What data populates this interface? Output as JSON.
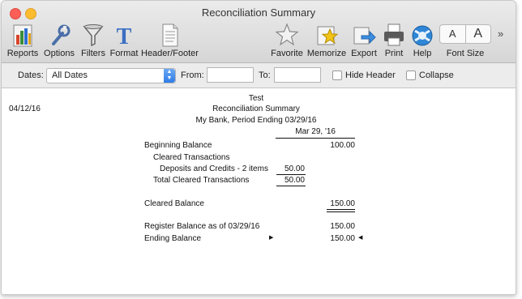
{
  "window": {
    "title": "Reconciliation Summary"
  },
  "toolbar": {
    "reports": "Reports",
    "options": "Options",
    "filters": "Filters",
    "format": "Format",
    "header_footer": "Header/Footer",
    "favorite": "Favorite",
    "memorize": "Memorize",
    "export": "Export",
    "print": "Print",
    "help": "Help",
    "font_size": "Font Size",
    "font_small": "A",
    "font_large": "A",
    "more": "»"
  },
  "filters": {
    "dates_label": "Dates:",
    "dates_value": "All Dates",
    "from_label": "From:",
    "to_label": "To:",
    "hide_header_label": "Hide Header",
    "collapse_label": "Collapse"
  },
  "report": {
    "date": "04/12/16",
    "file_name": "Test",
    "report_title": "Reconciliation Summary",
    "subtitle": "My Bank, Period Ending 03/29/16",
    "column_header": "Mar 29, '16",
    "rows": {
      "beginning_balance": {
        "label": "Beginning Balance",
        "value": "100.00"
      },
      "cleared_transactions": {
        "label": "Cleared Transactions"
      },
      "deposits_credits": {
        "label": "Deposits and Credits - 2 items",
        "value": "50.00"
      },
      "total_cleared": {
        "label": "Total Cleared Transactions",
        "value": "50.00"
      },
      "cleared_balance": {
        "label": "Cleared Balance",
        "value": "150.00"
      },
      "register_balance": {
        "label": "Register Balance as of 03/29/16",
        "value": "150.00"
      },
      "ending_balance": {
        "label": "Ending Balance",
        "value": "150.00"
      }
    }
  }
}
